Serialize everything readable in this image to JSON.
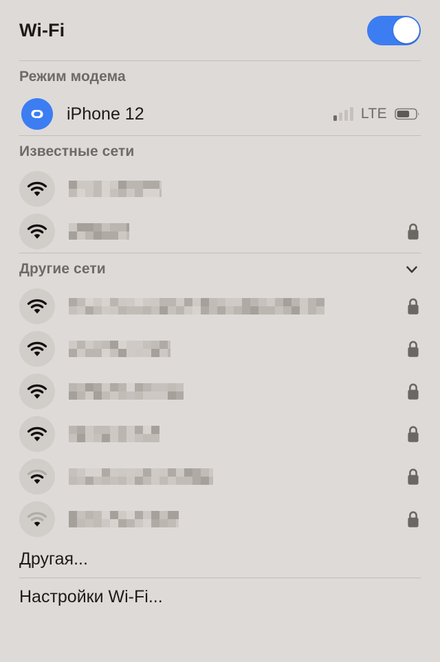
{
  "header": {
    "title": "Wi-Fi",
    "toggle": {
      "name": "wifi-power-toggle",
      "state": "on",
      "accent_color": "#3c7df2"
    }
  },
  "colors": {
    "background": "#dedad7",
    "separator": "#c2bdb9",
    "section_header_text": "#6e6a67",
    "primary_text": "#1d1b1a",
    "icon_circle": "#d1cdc9",
    "lock": "#6b6864",
    "accent_blue": "#3c7df2"
  },
  "sections": [
    {
      "id": "personal-hotspot",
      "title": "Режим модема",
      "collapsible": false,
      "rows": [
        {
          "icon": "hotspot-link-icon",
          "label": "iPhone 12",
          "redacted": false,
          "signal_bars": 1,
          "carrier": "LTE",
          "battery_percent": 60,
          "locked": false
        }
      ]
    },
    {
      "id": "known-networks",
      "title": "Известные сети",
      "collapsible": false,
      "rows": [
        {
          "icon": "wifi-icon",
          "label": "",
          "redacted": true,
          "redacted_width": 135,
          "signal_strength": 3,
          "locked": false
        },
        {
          "icon": "wifi-icon",
          "label": "",
          "redacted": true,
          "redacted_width": 88,
          "signal_strength": 3,
          "locked": true
        }
      ]
    },
    {
      "id": "other-networks",
      "title": "Другие сети",
      "collapsible": true,
      "chevron": "chevron-down-icon",
      "rows": [
        {
          "icon": "wifi-icon",
          "label": "",
          "redacted": true,
          "redacted_width": 372,
          "signal_strength": 3,
          "locked": true
        },
        {
          "icon": "wifi-icon",
          "label": "",
          "redacted": true,
          "redacted_width": 148,
          "signal_strength": 3,
          "locked": true
        },
        {
          "icon": "wifi-icon",
          "label": "",
          "redacted": true,
          "redacted_width": 167,
          "signal_strength": 3,
          "locked": true
        },
        {
          "icon": "wifi-icon",
          "label": "",
          "redacted": true,
          "redacted_width": 132,
          "signal_strength": 3,
          "locked": true
        },
        {
          "icon": "wifi-icon",
          "label": "",
          "redacted": true,
          "redacted_width": 210,
          "signal_strength": 2,
          "locked": true
        },
        {
          "icon": "wifi-icon",
          "label": "",
          "redacted": true,
          "redacted_width": 160,
          "signal_strength": 1,
          "locked": true
        }
      ]
    }
  ],
  "actions": {
    "other_network": "Другая...",
    "wifi_settings": "Настройки Wi-Fi..."
  }
}
